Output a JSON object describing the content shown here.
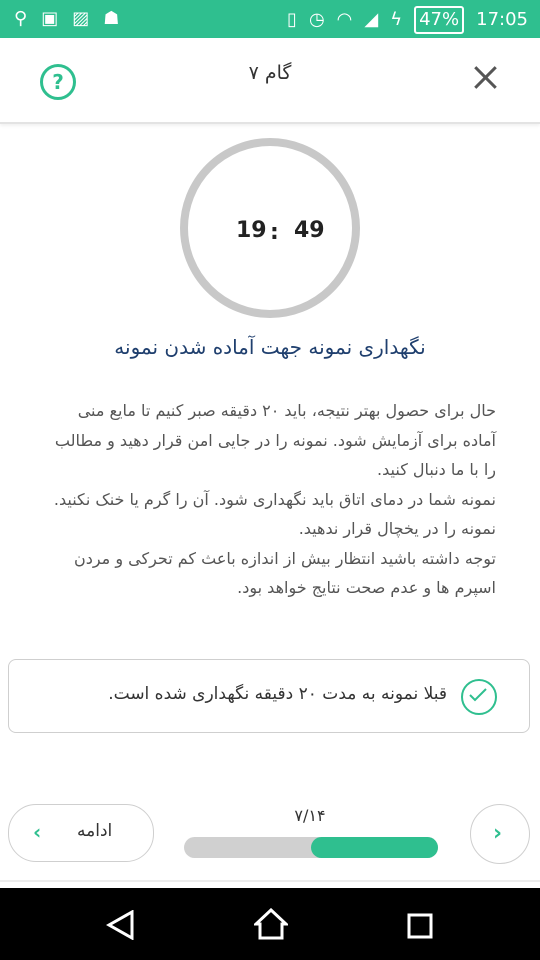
{
  "status_bar": {
    "icons": [
      "usb-icon",
      "sim-icon",
      "image-icon",
      "android-icon",
      "vibrate-icon",
      "alarm-icon",
      "wifi-icon",
      "signal-icon",
      "charging-icon"
    ],
    "battery": "47%",
    "time": "17:05"
  },
  "header": {
    "title": "گام ۷"
  },
  "timer": {
    "minutes": "19",
    "separator": ":",
    "seconds": "49"
  },
  "content": {
    "heading": "نگهداری نمونه جهت آماده شدن نمونه",
    "paragraphs": [
      "حال برای حصول بهتر نتیجه، باید ۲۰ دقیقه صبر کنیم تا مایع منی آماده برای آزمایش شود. نمونه را در جایی  امن قرار دهید و مطالب را با ما دنبال کنید.",
      "نمونه شما در دمای اتاق باید نگهداری شود. آن را گرم یا خنک نکنید. نمونه را در یخچال قرار ندهید.",
      "توجه داشته باشید انتظار بیش از اندازه باعث کم تحرکی و مردن اسپرم ها و عدم صحت نتایج خواهد بود."
    ]
  },
  "confirmation": {
    "label": "قبلا نمونه به مدت ۲۰ دقیقه نگهداری شده است."
  },
  "footer": {
    "progress_text": "۷/۱۴",
    "progress_fraction": 0.5,
    "continue_label": "ادامه"
  },
  "colors": {
    "accent": "#2fbf8f",
    "heading": "#1f3f6e",
    "timer_ring": "#c8c8c8"
  }
}
